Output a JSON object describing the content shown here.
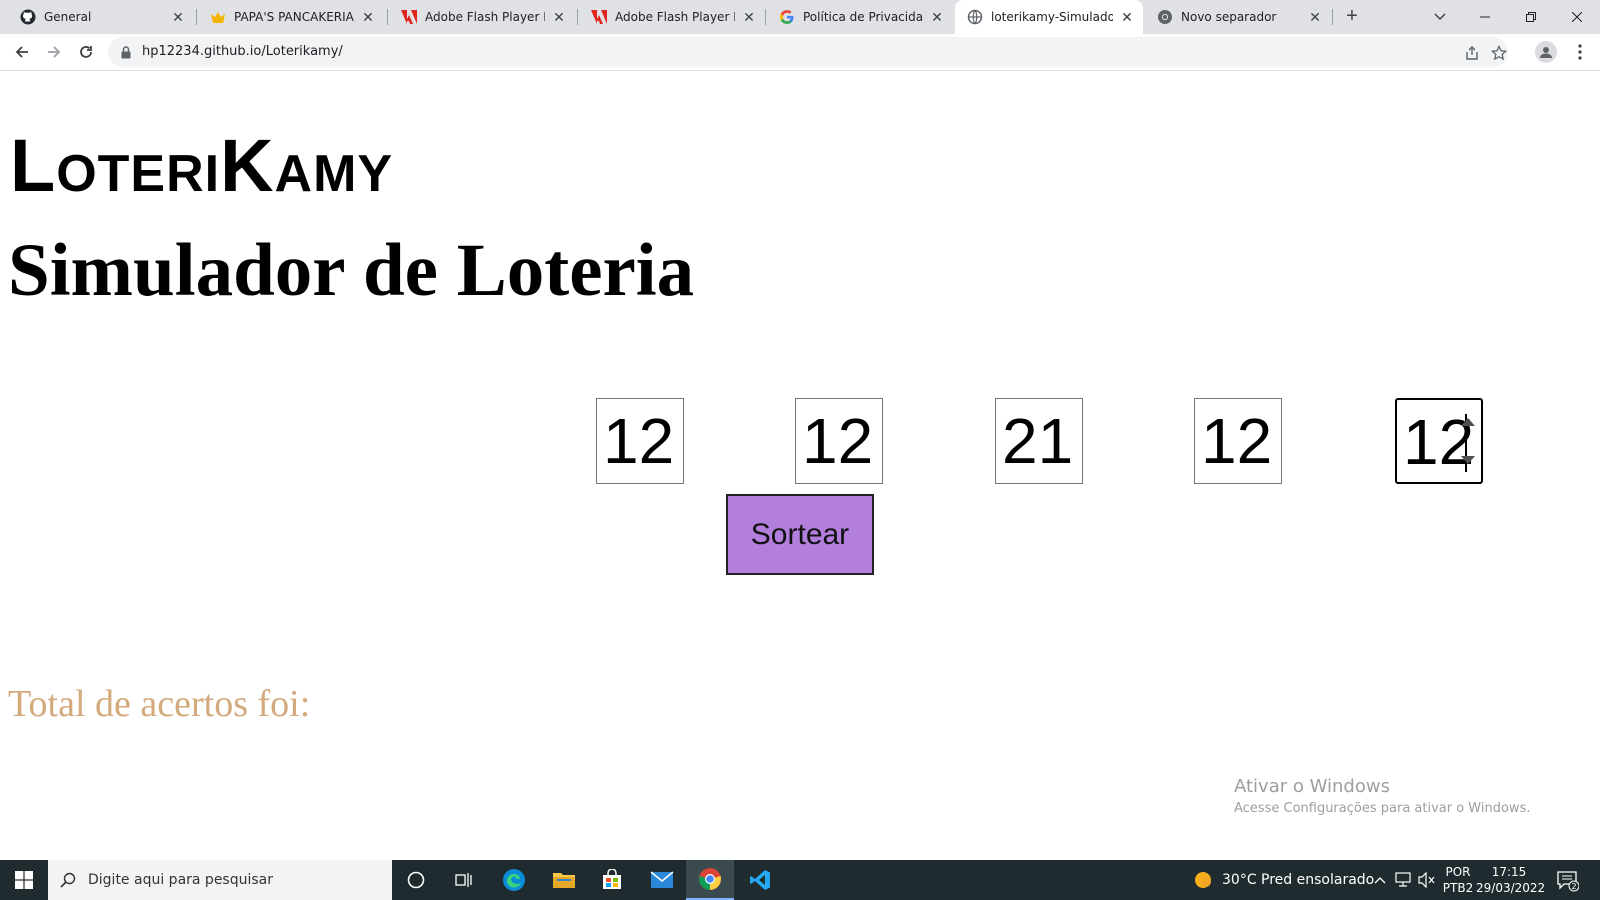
{
  "browser": {
    "tabs": [
      {
        "title": "General",
        "icon": "github-icon",
        "active": false
      },
      {
        "title": "PAPA'S PANCAKERIA jo",
        "icon": "crown-icon",
        "active": false
      },
      {
        "title": "Adobe Flash Player End",
        "icon": "adobe-icon",
        "active": false
      },
      {
        "title": "Adobe Flash Player End",
        "icon": "adobe-icon",
        "active": false
      },
      {
        "title": "Política de Privacidade",
        "icon": "google-icon",
        "active": false
      },
      {
        "title": "loterikamy-Simulador d",
        "icon": "globe-icon",
        "active": true
      },
      {
        "title": "Novo separador",
        "icon": "chrome-icon",
        "active": false
      }
    ],
    "new_tab": "+",
    "url": "hp12234.github.io/Loterikamy/"
  },
  "page": {
    "title": "LoteriKamy",
    "subtitle": "Simulador de Loteria",
    "numbers": [
      "12",
      "12",
      "21",
      "12",
      "12"
    ],
    "button_label": "Sortear",
    "result_label": "Total de acertos foi:",
    "watermark_title": "Ativar o Windows",
    "watermark_text": "Acesse Configurações para ativar o Windows."
  },
  "taskbar": {
    "search_placeholder": "Digite aqui para pesquisar",
    "weather": "30°C  Pred ensolarado",
    "lang_top": "POR",
    "lang_bottom": "PTB2",
    "time": "17:15",
    "date": "29/03/2022",
    "notifications": "2"
  },
  "colors": {
    "button": "#b37fdc",
    "result_text": "#d4aa7d",
    "taskbar": "#1f2b2e"
  }
}
